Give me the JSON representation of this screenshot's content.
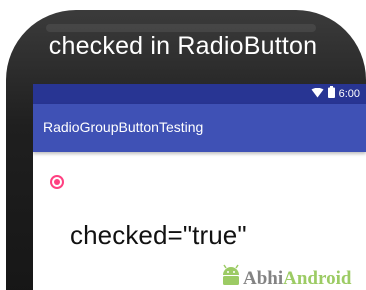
{
  "caption": "checked in RadioButton",
  "status_bar": {
    "time": "6:00",
    "color": "#283593"
  },
  "app_bar": {
    "title": "RadioGroupButtonTesting",
    "color": "#3f51b5"
  },
  "radio_button": {
    "checked": true,
    "accent_color": "#ff4081"
  },
  "content": {
    "code_text": "checked=\"true\""
  },
  "watermark": {
    "text_part1": "Abhi",
    "text_part2": "Android"
  }
}
